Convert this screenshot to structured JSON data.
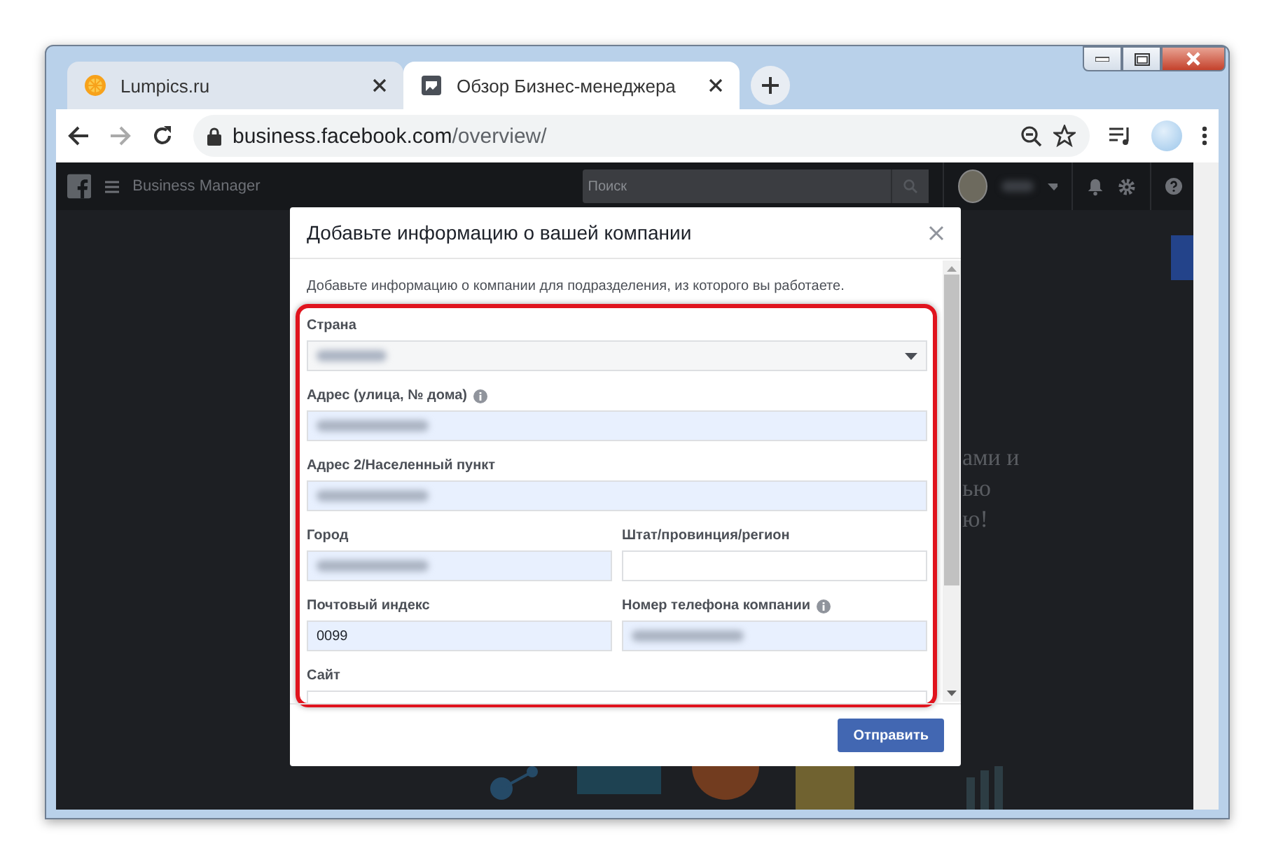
{
  "tabs": [
    {
      "title": "Lumpics.ru",
      "selected": false
    },
    {
      "title": "Обзор Бизнес-менеджера",
      "selected": true
    }
  ],
  "address_bar": {
    "host": "business.facebook.com",
    "path": "/overview/"
  },
  "page_header": {
    "title": "Business Manager",
    "search_placeholder": "Поиск",
    "account_redacted": true
  },
  "background_text": [
    "ами и",
    "ью",
    "ю!"
  ],
  "dialog": {
    "title": "Добавьте информацию о вашей компании",
    "intro": "Добавьте информацию о компании для подразделения, из которого вы работаете.",
    "highlighted": true,
    "rows": [
      {
        "fields": [
          {
            "kind": "select",
            "label": "Страна",
            "info": false,
            "redacted": true
          }
        ]
      },
      {
        "fields": [
          {
            "kind": "text",
            "label": "Адрес (улица, № дома)",
            "info": true,
            "autofilled": true,
            "redacted": true
          }
        ]
      },
      {
        "fields": [
          {
            "kind": "text",
            "label": "Адрес 2/Населенный пункт",
            "info": false,
            "autofilled": true,
            "redacted": true
          }
        ]
      },
      {
        "fields": [
          {
            "kind": "text",
            "label": "Город",
            "info": false,
            "autofilled": true,
            "redacted": true
          },
          {
            "kind": "text",
            "label": "Штат/провинция/регион",
            "info": false,
            "autofilled": false,
            "redacted": false
          }
        ]
      },
      {
        "fields": [
          {
            "kind": "text",
            "label": "Почтовый индекс",
            "info": false,
            "autofilled": true,
            "redacted": false,
            "value": "0099"
          },
          {
            "kind": "text",
            "label": "Номер телефона компании",
            "info": true,
            "autofilled": true,
            "redacted": true
          }
        ]
      },
      {
        "fields": [
          {
            "kind": "text",
            "label": "Сайт",
            "info": false,
            "autofilled": false,
            "redacted": false
          }
        ]
      }
    ],
    "submit": "Отправить"
  }
}
